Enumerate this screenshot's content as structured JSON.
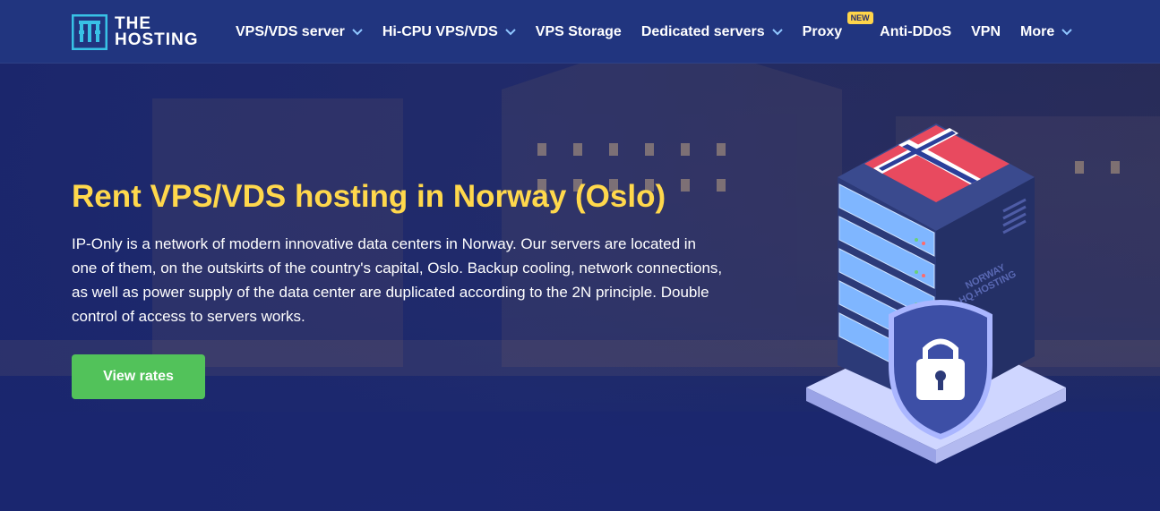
{
  "brand": {
    "logo_text_line1": "THE",
    "logo_text_line2": "HOSTING"
  },
  "nav": {
    "items": [
      {
        "label": "VPS/VDS server",
        "dropdown": true
      },
      {
        "label": "Hi-CPU VPS/VDS",
        "dropdown": true
      },
      {
        "label": "VPS Storage",
        "dropdown": false
      },
      {
        "label": "Dedicated servers",
        "dropdown": true
      },
      {
        "label": "Proxy",
        "dropdown": false,
        "badge": "NEW"
      },
      {
        "label": "Anti-DDoS",
        "dropdown": false
      },
      {
        "label": "VPN",
        "dropdown": false
      },
      {
        "label": "More",
        "dropdown": true
      }
    ]
  },
  "hero": {
    "title": "Rent VPS/VDS hosting in Norway (Oslo)",
    "description": "IP-Only is a network of modern innovative data centers in Norway. Our servers are located in one of them, on the outskirts of the country's capital, Oslo. Backup cooling, network connections, as well as power supply of the data center are duplicated according to the 2N principle. Double control of access to servers works.",
    "cta_label": "View rates"
  },
  "illustration": {
    "side_text_line1": "NORWAY",
    "side_text_line2": "HQ.HOSTING"
  },
  "colors": {
    "header_bg": "#21357f",
    "accent_yellow": "#ffd84c",
    "cta_green": "#52c25a",
    "badge_yellow": "#ffd54a"
  }
}
